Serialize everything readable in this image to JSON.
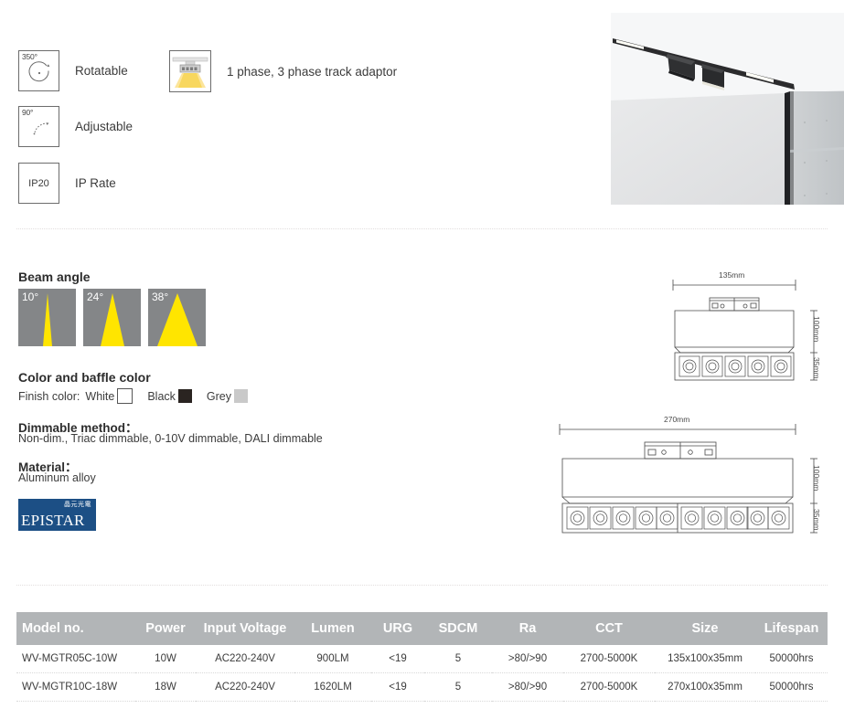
{
  "features": {
    "items": [
      {
        "icon": "rotation-350-icon",
        "badge": "350°",
        "label": "Rotatable"
      },
      {
        "icon": "tilt-90-icon",
        "badge": "90°",
        "label": "Adjustable"
      },
      {
        "icon": "ip-rating-icon",
        "badge": "IP20",
        "label": "IP Rate"
      }
    ],
    "track": {
      "icon": "track-adaptor-icon",
      "label": "1 phase, 3 phase track adaptor"
    }
  },
  "beam": {
    "title": "Beam angle",
    "angles": [
      {
        "label": "10°",
        "width": 9
      },
      {
        "label": "24°",
        "width": 26
      },
      {
        "label": "38°",
        "width": 44
      }
    ]
  },
  "color": {
    "title": "Color and baffle color",
    "finish_label": "Finish color:",
    "options": [
      {
        "name": "White",
        "hex": "#ffffff"
      },
      {
        "name": "Black",
        "hex": "#2a2421"
      },
      {
        "name": "Grey",
        "hex": "#c9c9c9"
      }
    ]
  },
  "dimmable": {
    "title": "Dimmable method：",
    "body": "Non-dim., Triac dimmable, 0-10V dimmable, DALI dimmable"
  },
  "material": {
    "title": "Material：",
    "body": "Aluminum alloy"
  },
  "brand": {
    "name": "EPISTAR",
    "cn": "晶元光電",
    "hex": "#1c4f85"
  },
  "drawings": [
    {
      "name": "5-cell-fixture",
      "width_label": "135mm",
      "height_label": "100mm",
      "face_label": "35mm",
      "cells": 5
    },
    {
      "name": "10-cell-fixture",
      "width_label": "270mm",
      "height_label": "100mm",
      "face_label": "35mm",
      "cells": 10
    }
  ],
  "table": {
    "headers": [
      "Model no.",
      "Power",
      "Input Voltage",
      "Lumen",
      "URG",
      "SDCM",
      "Ra",
      "CCT",
      "Size",
      "Lifespan"
    ],
    "rows": [
      [
        "WV-MGTR05C-10W",
        "10W",
        "AC220-240V",
        "900LM",
        "<19",
        "5",
        ">80/>90",
        "2700-5000K",
        "135x100x35mm",
        "50000hrs"
      ],
      [
        "WV-MGTR10C-18W",
        "18W",
        "AC220-240V",
        "1620LM",
        "<19",
        "5",
        ">80/>90",
        "2700-5000K",
        "270x100x35mm",
        "50000hrs"
      ]
    ],
    "header_bg": "#b2b5b7"
  }
}
